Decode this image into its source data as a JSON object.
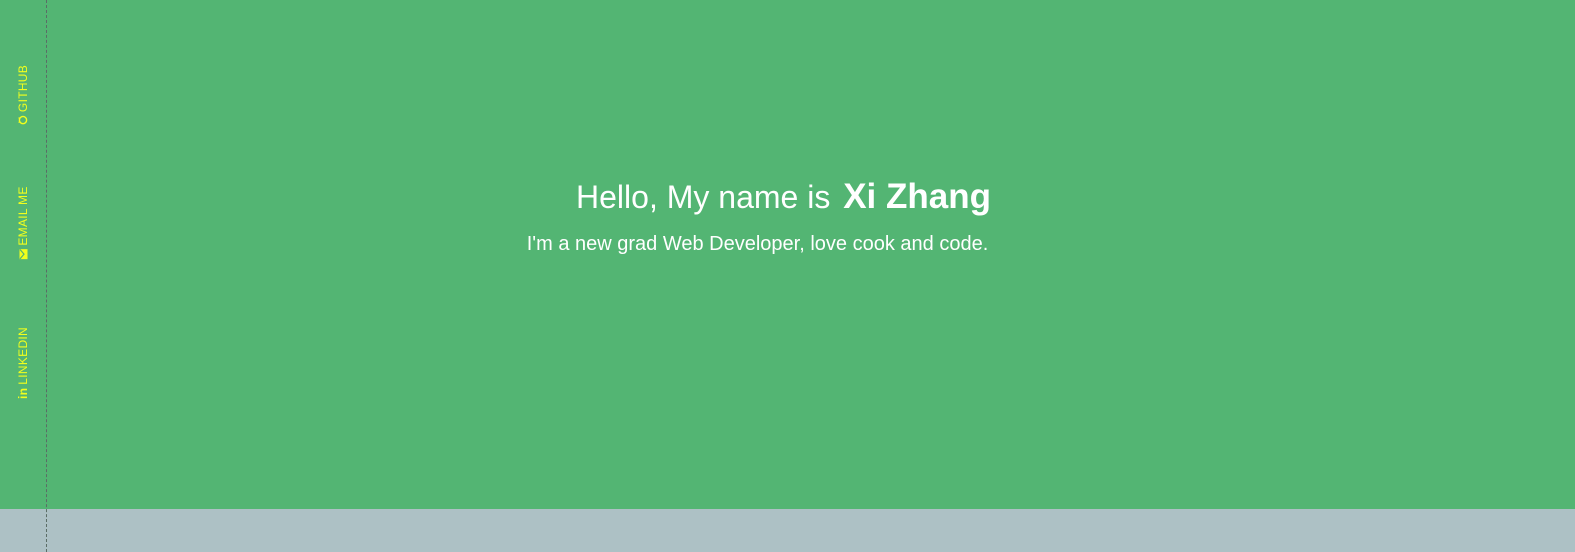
{
  "sidebar": {
    "github_label": "GITHUB",
    "email_label": "EMAIL ME",
    "linkedin_label": "LINKEDIN",
    "linkedin_icon_text": "in",
    "link_color": "#f2ff1c",
    "icons": {
      "github": "github-icon",
      "email": "envelope-icon",
      "linkedin": "linkedin-icon"
    }
  },
  "hero": {
    "greeting": "Hello, My name is",
    "name": "Xi Zhang",
    "tagline": "I'm a new grad Web Developer, love cook and code.",
    "background_color": "#53b573",
    "text_color": "#ffffff"
  },
  "footer": {
    "background_color": "#adc1c5"
  }
}
